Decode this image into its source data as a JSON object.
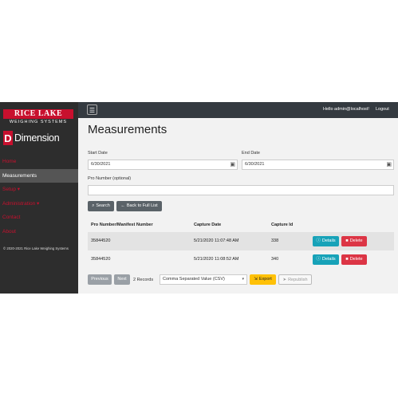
{
  "brand": {
    "company_top": "RICE LAKE",
    "company_bottom": "WEIGHING SYSTEMS",
    "product_mark": "D",
    "product_name": "Dimension",
    "accent_color": "#c8102e"
  },
  "sidebar": {
    "items": [
      {
        "label": "Home"
      },
      {
        "label": "Measurements"
      },
      {
        "label": "Setup ▾"
      },
      {
        "label": "Administration ▾"
      },
      {
        "label": "Contact"
      },
      {
        "label": "About"
      }
    ],
    "footer": "© 2020-2021 Rice Lake Weighing Systems"
  },
  "topbar": {
    "menu_icon": "hamburger-icon",
    "greeting": "Hello admin@localhost!",
    "logout_label": "Logout"
  },
  "main": {
    "title": "Measurements",
    "start_date": {
      "label": "Start Date",
      "value": "6/30/2021"
    },
    "end_date": {
      "label": "End Date",
      "value": "6/30/2021"
    },
    "pro_number": {
      "label": "Pro Number (optional)",
      "value": ""
    },
    "search_label": "Search",
    "back_label": "Back to Full List",
    "table": {
      "headers": [
        "Pro Number/Manifest Number",
        "Capture Date",
        "Capture Id"
      ],
      "rows": [
        {
          "pro": "35844520",
          "date": "5/21/2020 11:07:48 AM",
          "id": "338"
        },
        {
          "pro": "35844520",
          "date": "5/21/2020 11:08:52 AM",
          "id": "340"
        }
      ],
      "details_label": "Details",
      "delete_label": "Delete"
    },
    "pager": {
      "previous_label": "Previous",
      "next_label": "Next",
      "records_text": "2 Records"
    },
    "export_format": "Comma Separated Value (CSV)",
    "export_label": "Export",
    "republish_label": "Republish"
  }
}
